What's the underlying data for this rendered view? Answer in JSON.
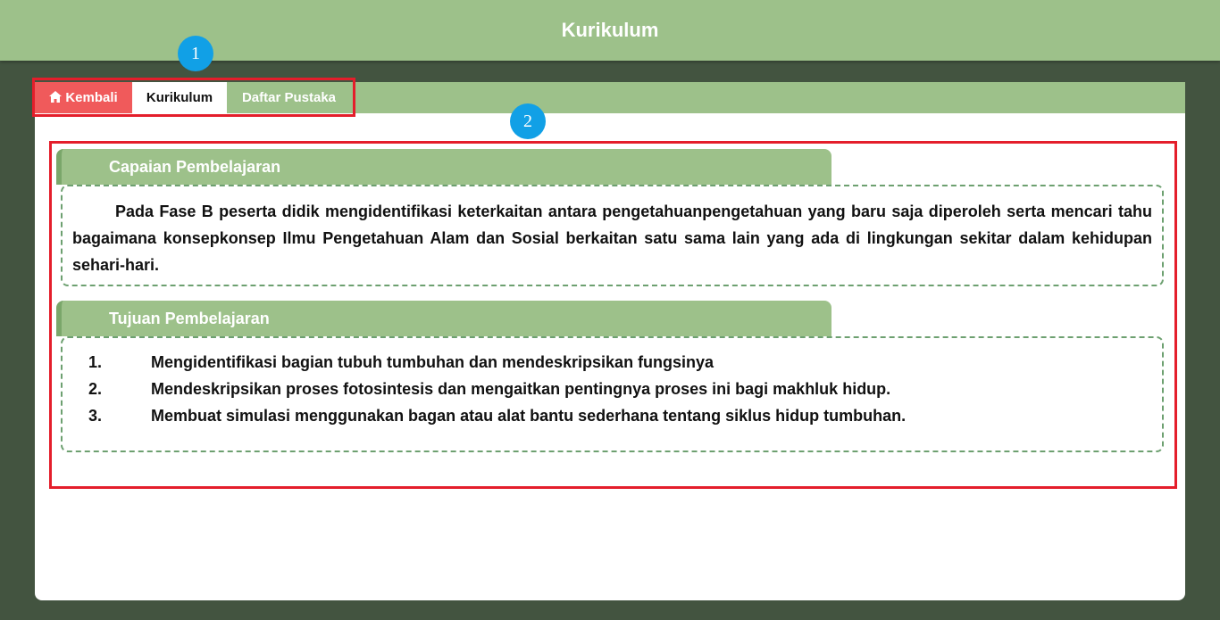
{
  "header": {
    "title": "Kurikulum"
  },
  "tabs": [
    {
      "label": "Kembali",
      "icon": "home-icon",
      "color": "#f05a5b"
    },
    {
      "label": "Kurikulum",
      "active": true
    },
    {
      "label": "Daftar Pustaka"
    }
  ],
  "annotations": {
    "badge1": "1",
    "badge2": "2",
    "box_color": "#e41e2b",
    "badge_color": "#11a0e6"
  },
  "capaian": {
    "title": "Capaian Pembelajaran",
    "text": "Pada Fase B peserta didik mengidentifikasi keterkaitan antara pengetahuanpengetahuan yang baru saja diperoleh serta mencari tahu bagaimana konsepkonsep Ilmu Pengetahuan Alam dan Sosial berkaitan satu sama lain yang ada di lingkungan sekitar dalam kehidupan sehari-hari."
  },
  "tujuan": {
    "title": "Tujuan Pembelajaran",
    "items": [
      {
        "num": "1.",
        "text": "Mengidentifikasi bagian tubuh tumbuhan dan mendeskripsikan fungsinya"
      },
      {
        "num": "2.",
        "text": "Mendeskripsikan proses fotosintesis dan mengaitkan pentingnya proses ini bagi makhluk hidup."
      },
      {
        "num": "3.",
        "text": "Membuat simulasi menggunakan bagan atau alat bantu sederhana tentang siklus hidup tumbuhan."
      }
    ]
  },
  "colors": {
    "accent_green": "#9dc18a",
    "background": "#435440"
  }
}
